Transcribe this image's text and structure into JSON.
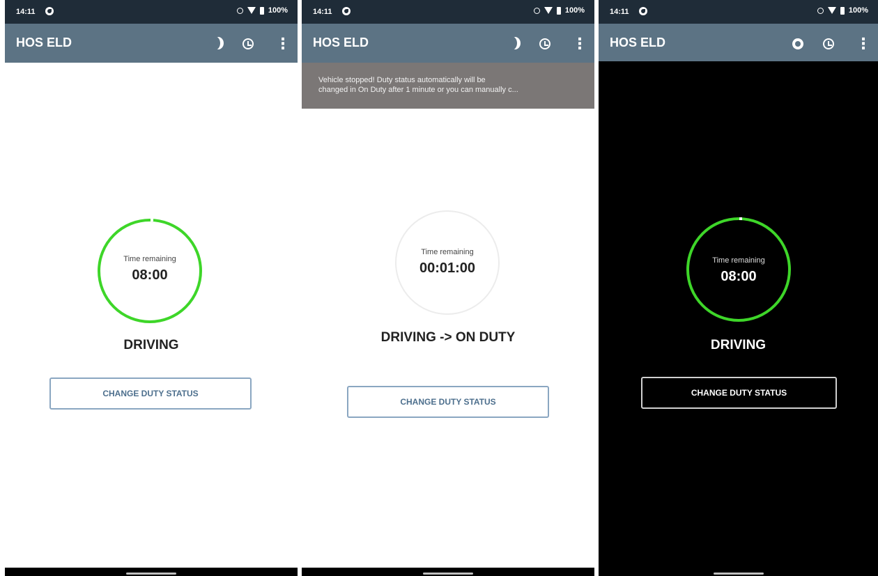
{
  "screens": [
    {
      "status_time": "14:11",
      "battery": "100%",
      "app_title": "HOS ELD",
      "theme_toggle_icon": "moon-icon",
      "banner": "",
      "time_label": "Time remaining",
      "time_value": "08:00",
      "duty_status": "DRIVING",
      "button_label": "CHANGE DUTY STATUS"
    },
    {
      "status_time": "14:11",
      "battery": "100%",
      "app_title": "HOS ELD",
      "theme_toggle_icon": "moon-icon",
      "banner": "Vehicle stopped! Duty status automatically will be\nchanged in On Duty after 1 minute or you can manually c...",
      "time_label": "Time remaining",
      "time_value": "00:01:00",
      "duty_status": "DRIVING -> ON DUTY",
      "button_label": "CHANGE DUTY STATUS"
    },
    {
      "status_time": "14:11",
      "battery": "100%",
      "app_title": "HOS ELD",
      "theme_toggle_icon": "sun-icon",
      "banner": "",
      "time_label": "Time remaining",
      "time_value": "08:00",
      "duty_status": "DRIVING",
      "button_label": "CHANGE DUTY STATUS"
    }
  ],
  "colors": {
    "app_bar": "#5c7384",
    "status_bar": "#1f2c38",
    "ring_active": "#3ed629",
    "banner": "#7b7776",
    "button_border": "#8aa6c1"
  }
}
